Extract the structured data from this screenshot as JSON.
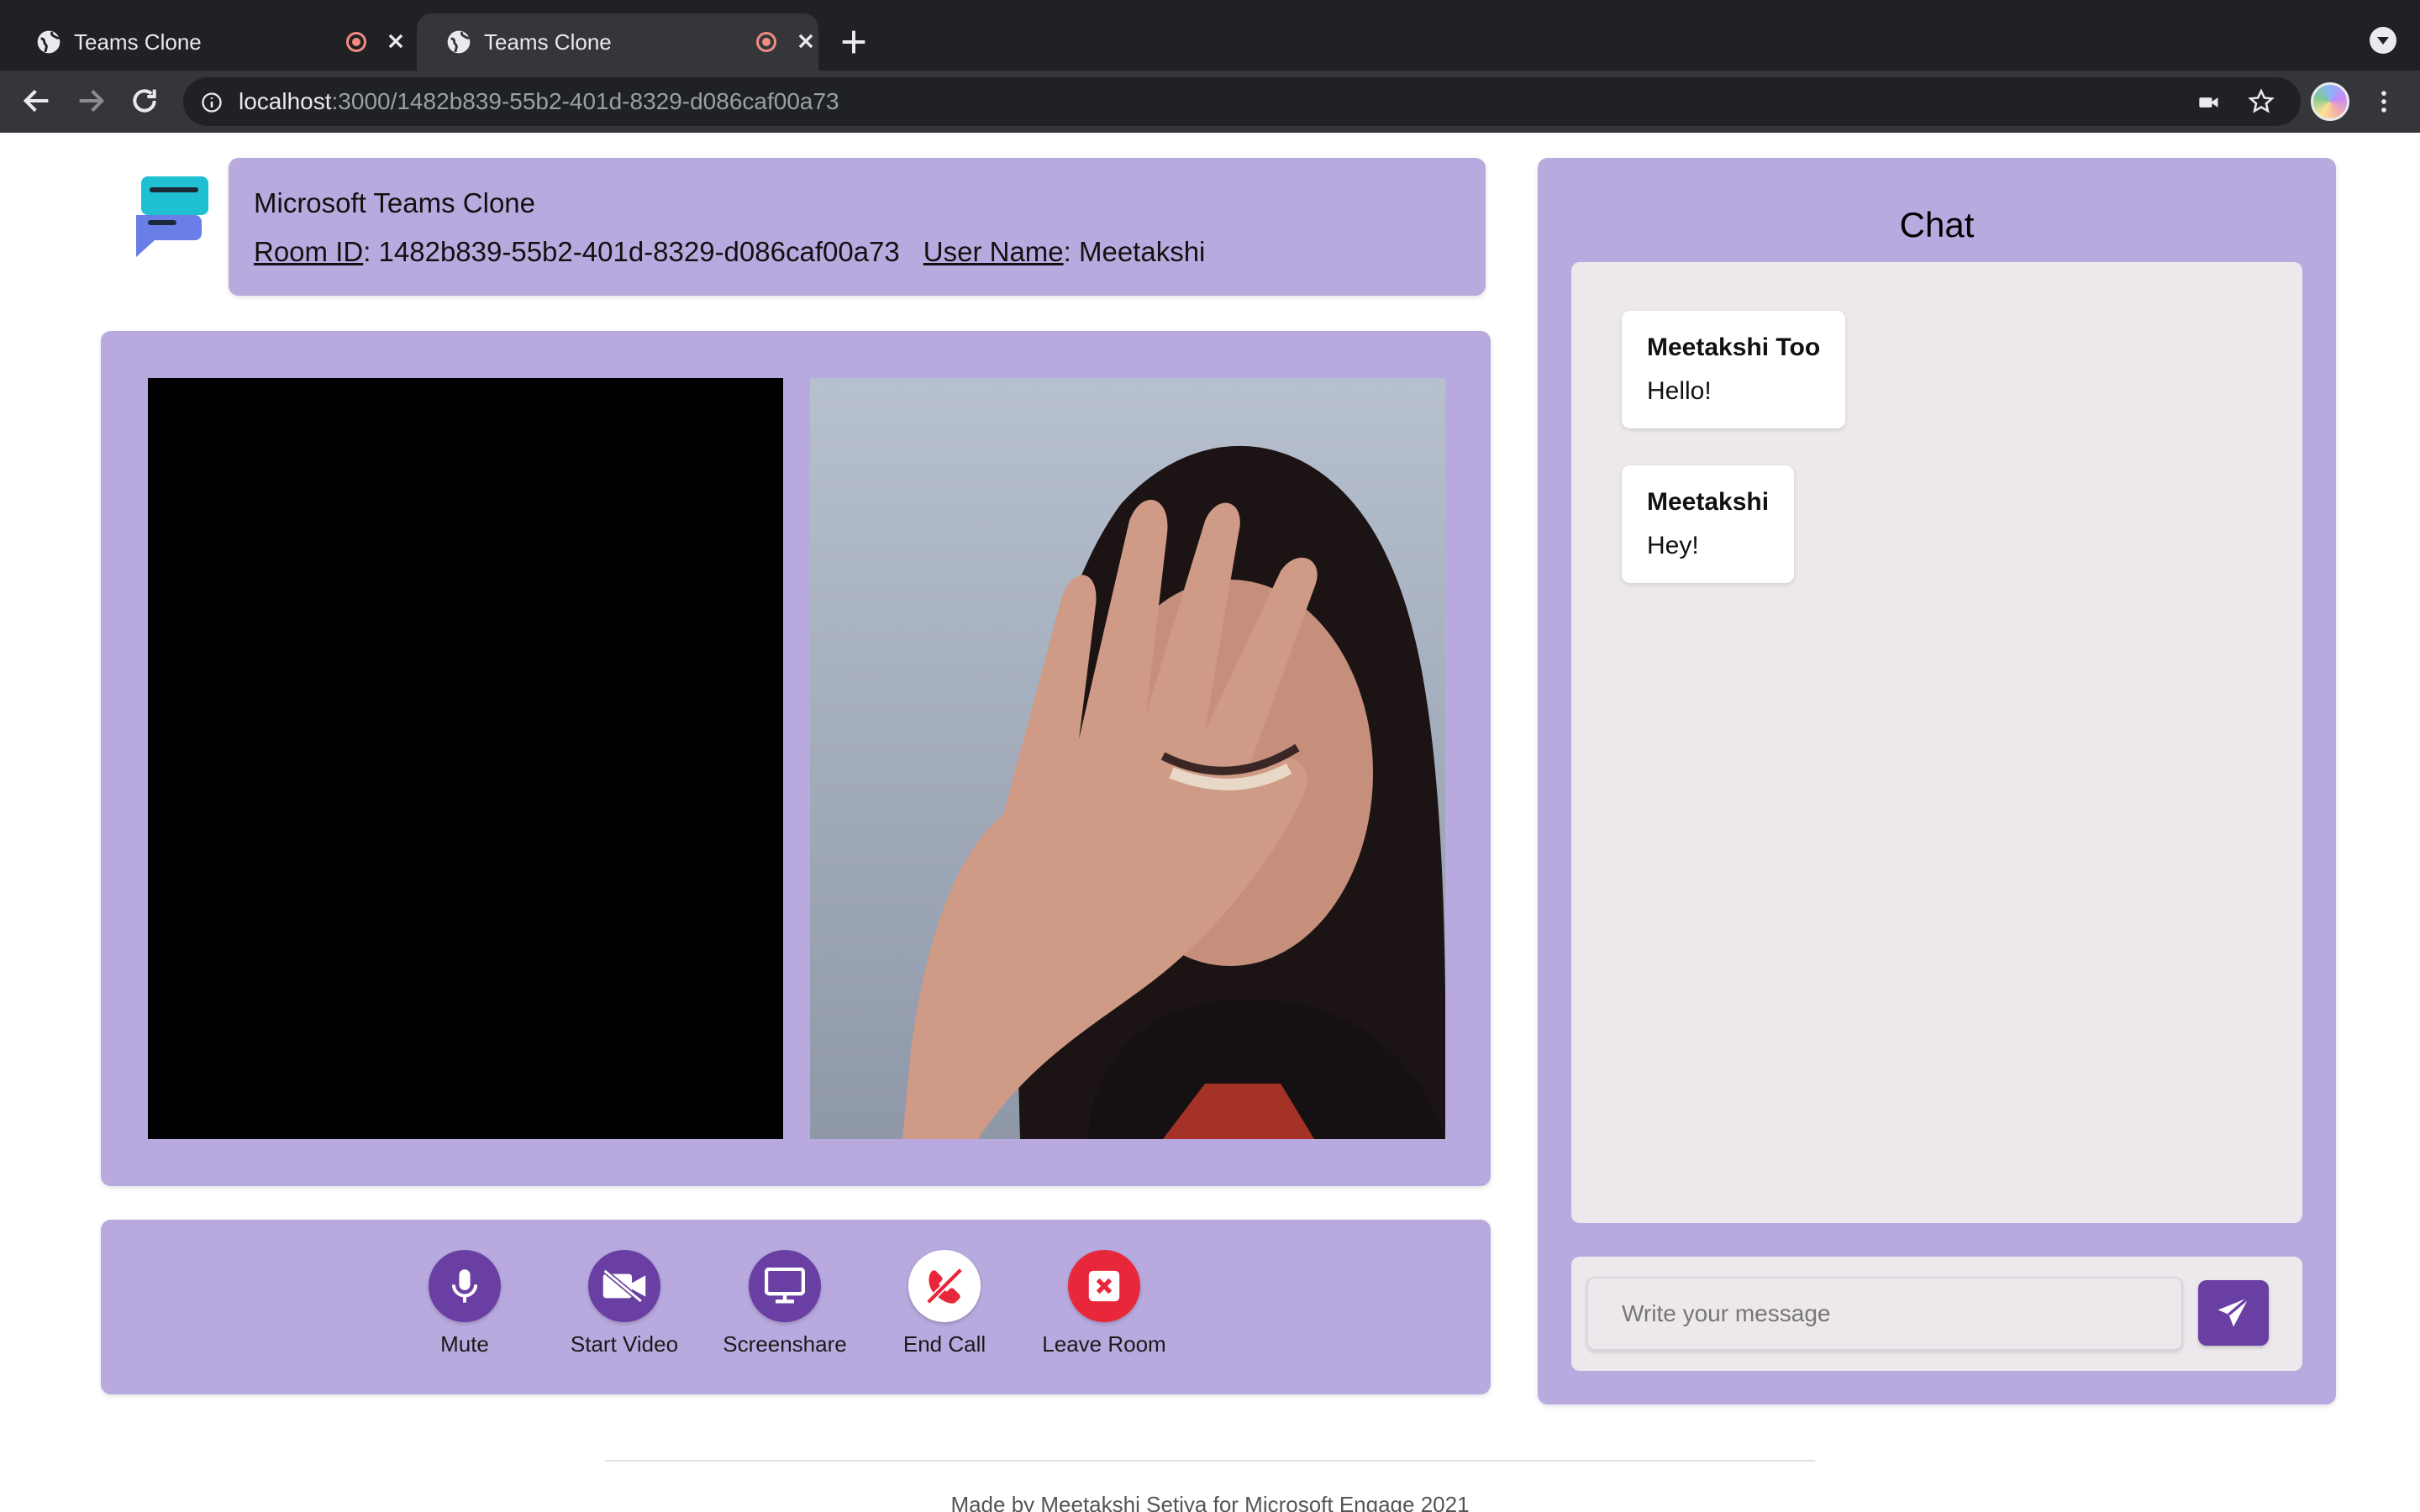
{
  "browser": {
    "tabs": [
      {
        "title": "Teams Clone",
        "active": false
      },
      {
        "title": "Teams Clone",
        "active": true
      }
    ],
    "url_host": "localhost",
    "url_path": ":3000/1482b839-55b2-401d-8329-d086caf00a73"
  },
  "header": {
    "app_title": "Microsoft Teams Clone",
    "room_id_label": "Room ID",
    "room_id_value": ": 1482b839-55b2-401d-8329-d086caf00a73",
    "user_name_label": "User Name",
    "user_name_value": ": Meetakshi"
  },
  "controls": [
    {
      "label": "Mute",
      "icon": "microphone-icon",
      "color": "#6a3fa3"
    },
    {
      "label": "Start Video",
      "icon": "video-off-icon",
      "color": "#6a3fa3"
    },
    {
      "label": "Screenshare",
      "icon": "monitor-icon",
      "color": "#6a3fa3"
    },
    {
      "label": "End Call",
      "icon": "phone-slash-icon",
      "color": "#ffffff"
    },
    {
      "label": "Leave Room",
      "icon": "close-square-icon",
      "color": "#e8283a"
    }
  ],
  "chat": {
    "title": "Chat",
    "messages": [
      {
        "sender": "Meetakshi Too",
        "text": "Hello!"
      },
      {
        "sender": "Meetakshi",
        "text": "Hey!"
      }
    ],
    "input_placeholder": "Write your message",
    "send_icon": "send-icon"
  },
  "footer": {
    "text": "Made by Meetakshi Setiya for Microsoft Engage 2021"
  },
  "colors": {
    "panel": "#b8aadf",
    "accent": "#6a3fa3",
    "danger": "#e8283a",
    "chat_bg": "#ece8ec"
  }
}
